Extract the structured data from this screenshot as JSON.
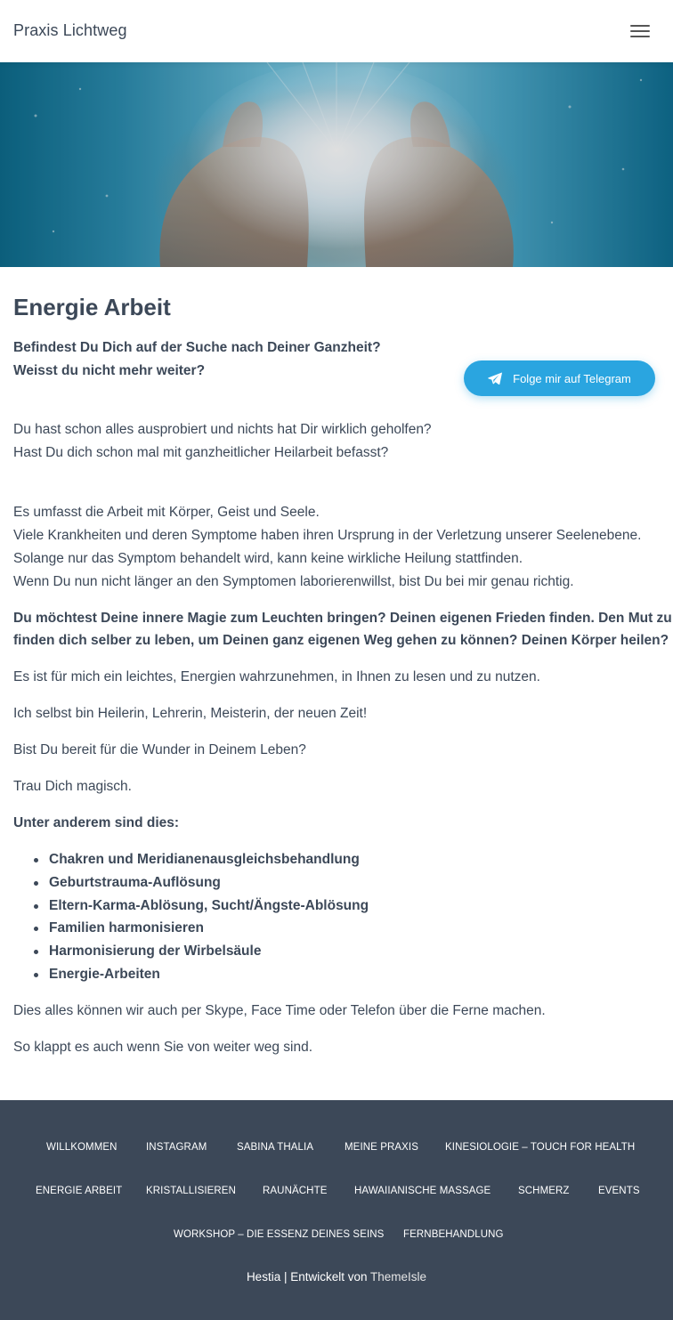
{
  "header": {
    "brand": "Praxis Lichtweg",
    "menu_icon": "hamburger-menu-icon"
  },
  "hero": {
    "image": "cupped-hands-glowing-light"
  },
  "main": {
    "title": "Energie Arbeit",
    "intro_bold_1": "Befindest Du Dich auf der Suche nach Deiner Ganzheit?",
    "intro_bold_2": "Weisst du nicht mehr weiter?",
    "q1": "Du hast schon alles ausprobiert und nichts hat Dir wirklich geholfen?",
    "q2": "Hast Du dich schon mal mit ganzheitlicher Heilarbeit befasst?",
    "p1": "Es umfasst die Arbeit mit Körper, Geist und Seele.",
    "p2": "Viele Krankheiten und deren Symptome haben ihren Ursprung in der Verletzung unserer Seelenebene.",
    "p3": "Solange nur das Symptom behandelt wird, kann keine wirkliche Heilung stattfinden.",
    "p4": "Wenn Du nun nicht länger an den Symptomen laborierenwillst, bist Du bei mir genau richtig.",
    "bold_block_1": "Du möchtest Deine innere Magie zum Leuchten bringen? Deinen eigenen Frieden finden. Den Mut zu",
    "bold_block_2": "finden dich selber zu leben, um Deinen ganz eigenen Weg gehen zu können? Deinen Körper heilen?",
    "p5": "Es ist für mich ein leichtes, Energien wahrzunehmen, in Ihnen zu lesen und zu nutzen.",
    "p6": "Ich selbst bin Heilerin, Lehrerin, Meisterin, der neuen Zeit!",
    "p7": "Bist Du bereit für die Wunder in Deinem Leben?",
    "p8": "Trau Dich magisch.",
    "list_heading": "Unter anderem sind dies:",
    "list": [
      "Chakren und Meridianenausgleichsbehandlung",
      "Geburtstrauma-Auflösung",
      "Eltern-Karma-Ablösung, Sucht/Ängste-Ablösung",
      "Familien harmonisieren",
      "Harmonisierung der Wirbelsäule",
      "Energie-Arbeiten"
    ],
    "p9": "Dies alles können wir auch per Skype, Face Time oder Telefon über die Ferne machen.",
    "p10": "So klappt  es auch wenn Sie von weiter weg sind."
  },
  "telegram_button": {
    "label": "Folge mir auf Telegram",
    "icon": "telegram-paper-plane-icon",
    "color": "#2aa5e0"
  },
  "footer": {
    "nav": [
      "Willkommen",
      "Instagram",
      "Sabina Thalia",
      "Meine Praxis",
      "Kinesiologie – Touch for Health",
      "Energie Arbeit",
      "Kristallisieren",
      "Raunächte",
      "Hawaiianische Massage",
      "Schmerz",
      "Events",
      "Workshop – Die Essenz Deines Seins",
      "Fernbehandlung"
    ],
    "credit_prefix": "Hestia | Entwickelt von ",
    "credit_link": "ThemeIsle",
    "bg_color": "#3c4858"
  }
}
